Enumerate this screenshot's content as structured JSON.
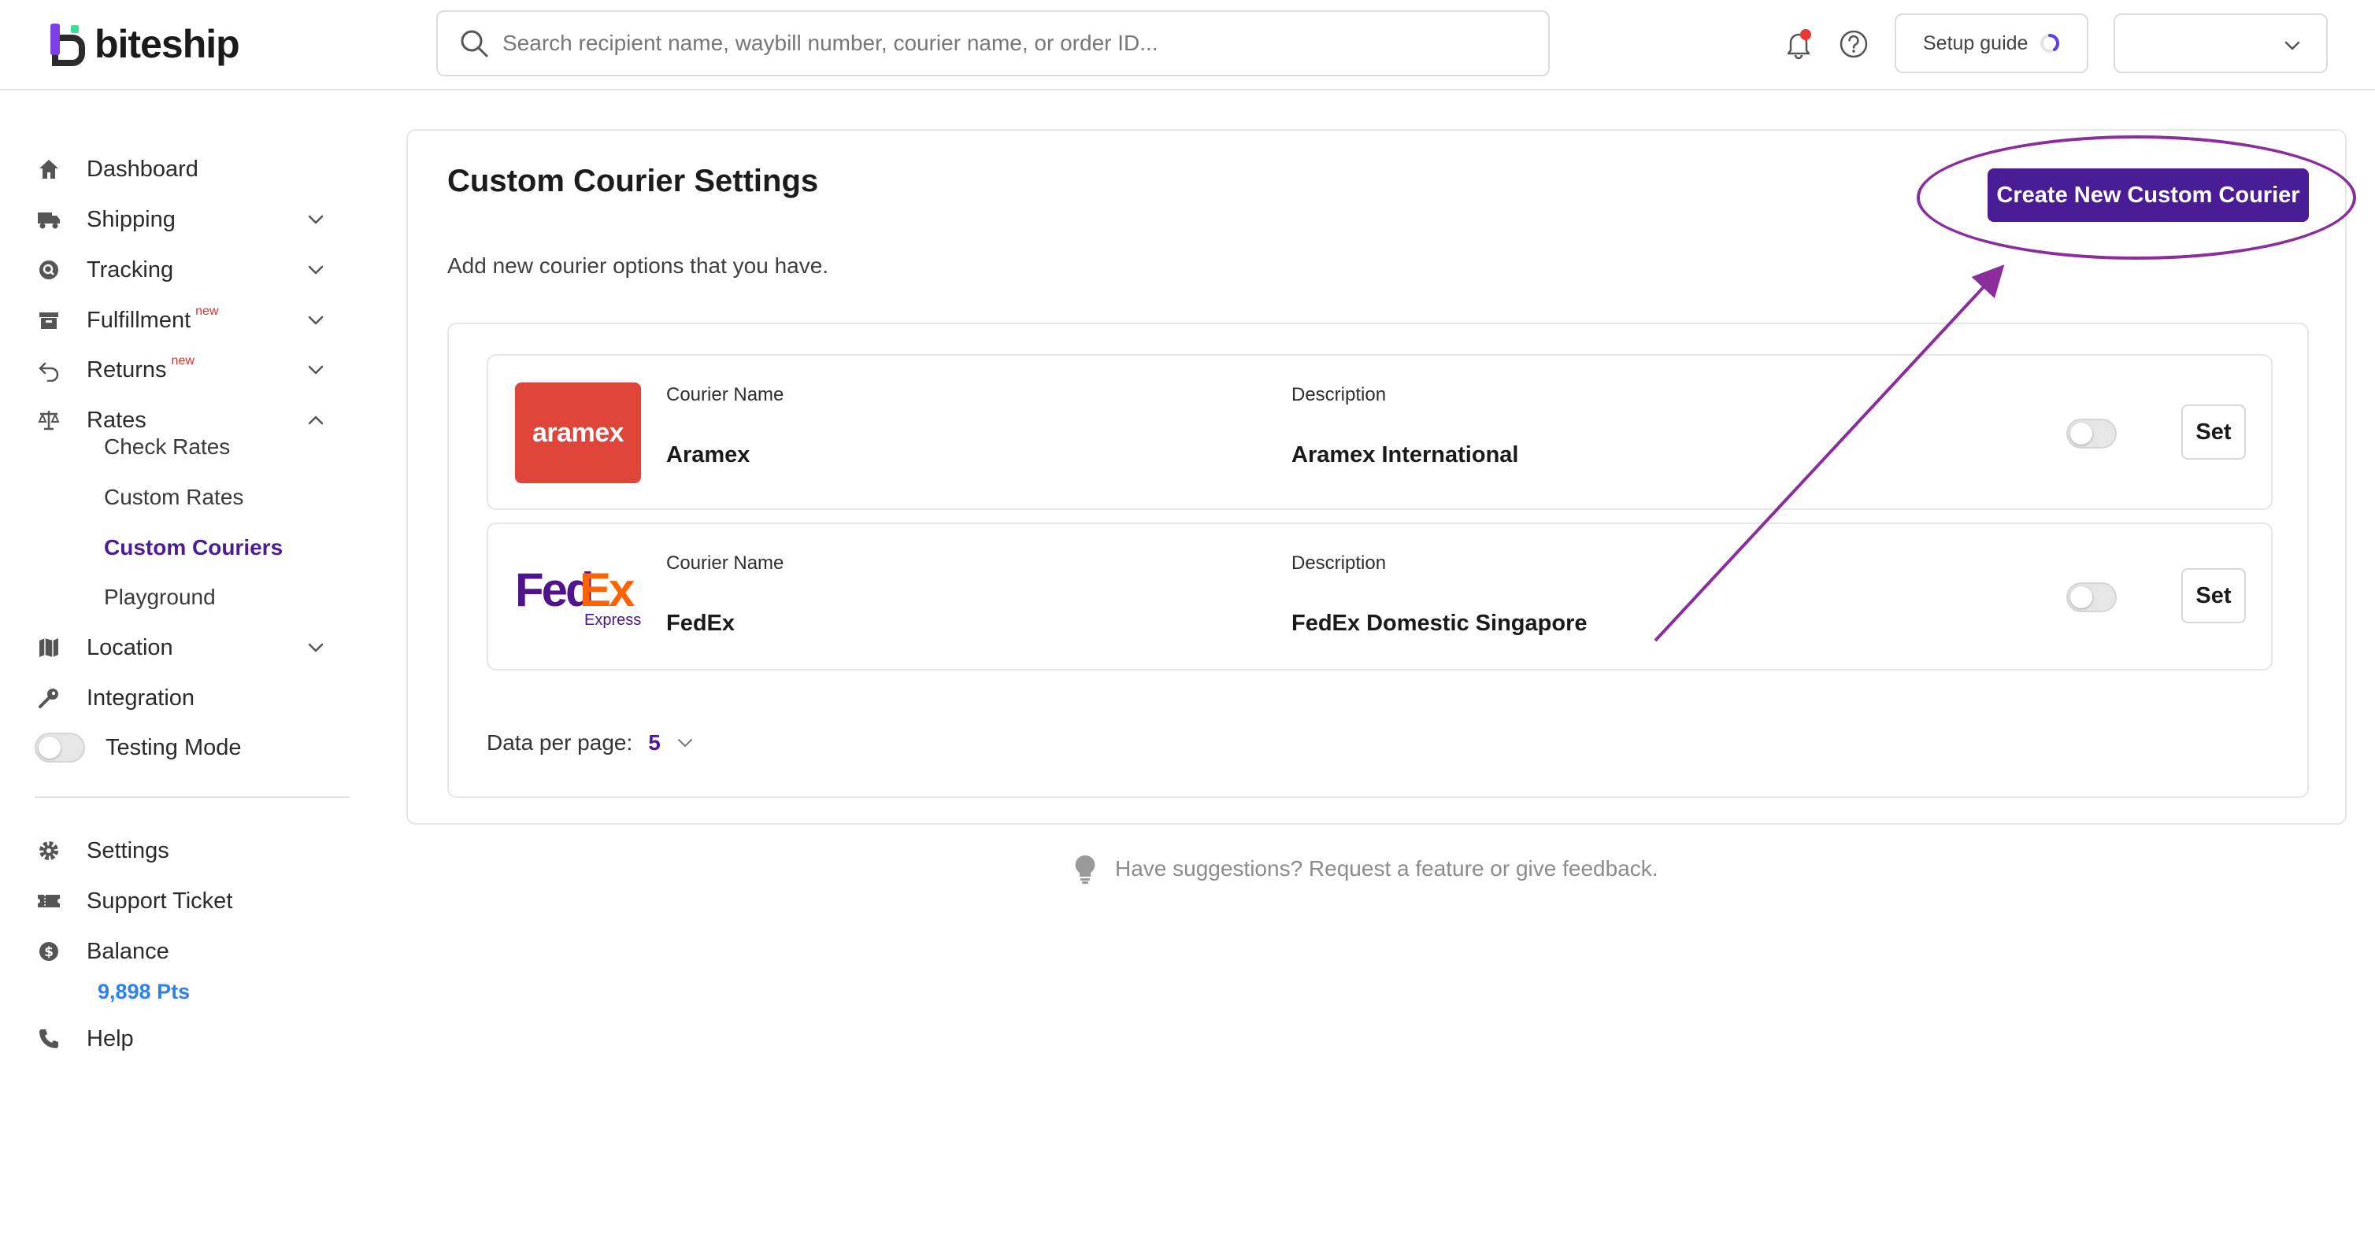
{
  "brand": {
    "name": "biteship"
  },
  "search": {
    "placeholder": "Search recipient name, waybill number, courier name, or order ID..."
  },
  "header": {
    "setup_label": "Setup guide"
  },
  "sidebar": {
    "items": [
      {
        "label": "Dashboard"
      },
      {
        "label": "Shipping"
      },
      {
        "label": "Tracking"
      },
      {
        "label": "Fulfillment",
        "badge": "new"
      },
      {
        "label": "Returns",
        "badge": "new"
      },
      {
        "label": "Rates"
      },
      {
        "label": "Location"
      },
      {
        "label": "Integration"
      }
    ],
    "rates_sub": [
      {
        "label": "Check Rates"
      },
      {
        "label": "Custom Rates"
      },
      {
        "label": "Custom Couriers"
      },
      {
        "label": "Playground"
      }
    ],
    "testing_label": "Testing Mode",
    "bottom": [
      {
        "label": "Settings"
      },
      {
        "label": "Support Ticket"
      },
      {
        "label": "Balance"
      },
      {
        "label": "Help"
      }
    ],
    "balance_points": "9,898 Pts"
  },
  "main": {
    "title": "Custom Courier Settings",
    "subtitle": "Add new courier options that you have.",
    "create_label": "Create New Custom Courier",
    "name_label": "Courier Name",
    "desc_label": "Description",
    "set_label": "Set",
    "couriers": [
      {
        "logo_text": "aramex",
        "name": "Aramex",
        "description": "Aramex International",
        "enabled": false
      },
      {
        "logo_text": "FedEx",
        "logo_sub": "Express",
        "name": "FedEx",
        "description": "FedEx Domestic Singapore",
        "enabled": false
      }
    ],
    "per_page_label": "Data per page:",
    "per_page_value": "5"
  },
  "feedback": {
    "text": "Have suggestions? Request a feature or give feedback."
  },
  "colors": {
    "primary": "#4a1d96",
    "annotation": "#8a2e9e",
    "aramex": "#e0453a",
    "link": "#2f80ed"
  }
}
